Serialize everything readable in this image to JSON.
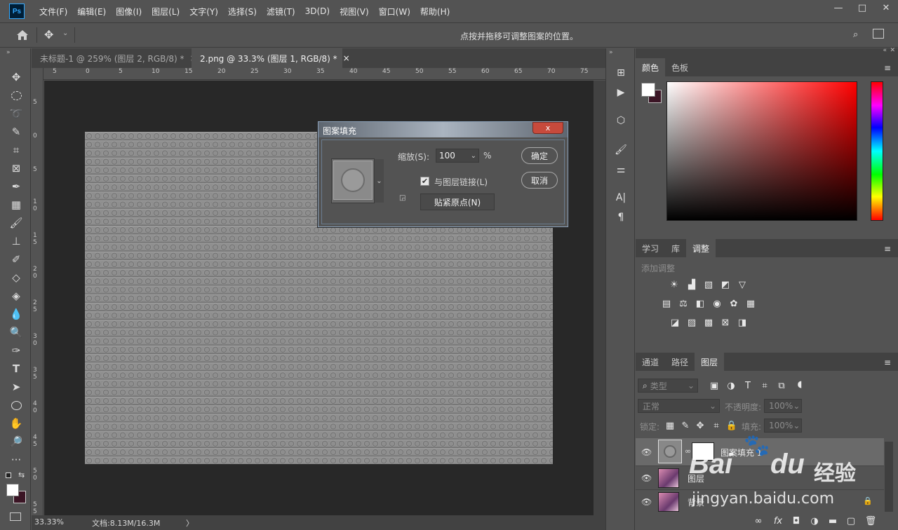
{
  "app": {
    "logo": "Ps"
  },
  "menu": [
    "文件(F)",
    "编辑(E)",
    "图像(I)",
    "图层(L)",
    "文字(Y)",
    "选择(S)",
    "滤镜(T)",
    "3D(D)",
    "视图(V)",
    "窗口(W)",
    "帮助(H)"
  ],
  "window_controls": {
    "minimize": "—",
    "restore": "□",
    "close": "✕"
  },
  "options": {
    "hint": "点按并拖移可调整图案的位置。"
  },
  "tabs": [
    {
      "label": "未标题-1 @ 259% (图层 2, RGB/8) *",
      "close": "×"
    },
    {
      "label": "2.png @ 33.3% (图层 1, RGB/8) *",
      "close": "×"
    }
  ],
  "ruler_h": [
    "5",
    "0",
    "5",
    "10",
    "15",
    "20",
    "25",
    "30",
    "35",
    "40",
    "45",
    "50",
    "55",
    "60",
    "65",
    "70",
    "75"
  ],
  "ruler_v": [
    "5",
    "0",
    "5",
    "1\n0",
    "1\n5",
    "2\n0",
    "2\n5",
    "3\n0",
    "3\n5",
    "4\n0",
    "4\n5",
    "5\n0",
    "5\n5"
  ],
  "status": {
    "zoom": "33.33%",
    "doc": "文档:8.13M/16.3M",
    "arrow": "〉"
  },
  "color_panel": {
    "tabs": [
      "颜色",
      "色板"
    ],
    "active": "颜色"
  },
  "adjust_panel": {
    "tabs": [
      "学习",
      "库",
      "调整"
    ],
    "active": "调整",
    "add_label": "添加调整"
  },
  "layers_panel": {
    "tabs": [
      "通道",
      "路径",
      "图层"
    ],
    "active": "图层",
    "filter_label": "类型",
    "blend_mode": "正常",
    "opacity_label": "不透明度:",
    "opacity_value": "100%",
    "lock_label": "锁定:",
    "fill_label": "填充:",
    "fill_value": "100%",
    "layers": [
      {
        "name": "图案填充 1",
        "type": "fill"
      },
      {
        "name": "图层",
        "type": "image"
      },
      {
        "name": "背景",
        "type": "image"
      }
    ],
    "footer_fx": "fx"
  },
  "dialog": {
    "title": "图案填充",
    "close": "x",
    "scale_label": "缩放(S):",
    "scale_value": "100",
    "percent": "%",
    "link_label": "与图层链接(L)",
    "snap_label": "贴紧原点(N)",
    "ok": "确定",
    "cancel": "取消"
  },
  "watermark": {
    "text": "Bai",
    "text2": "du",
    "text3": "经验",
    "url": "jingyan.baidu.com"
  }
}
